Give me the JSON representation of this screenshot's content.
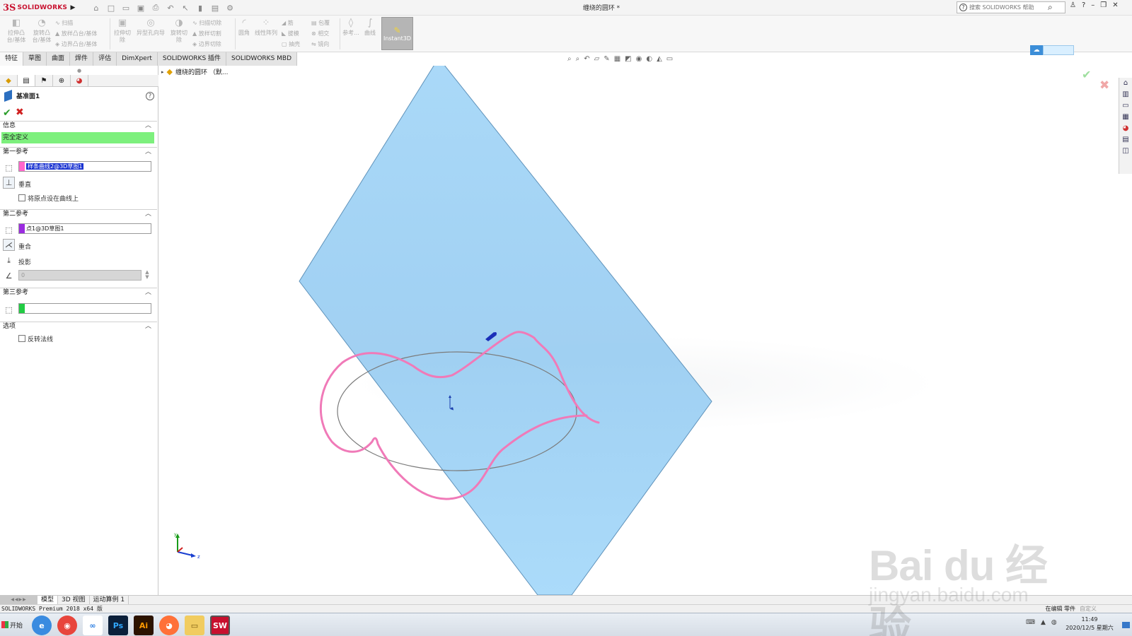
{
  "app": {
    "logo_text": "SOLIDWORKS",
    "document_title": "缠绕的圆环 *",
    "search_placeholder": "搜索 SOLIDWORKS 帮助"
  },
  "ribbon": {
    "extrude_boss": "拉伸凸台/基体",
    "revolve_boss": "旋转凸台/基体",
    "sweep": "扫描",
    "loft": "放样凸台/基体",
    "boundary": "边界凸台/基体",
    "extrude_cut": "拉伸切除",
    "hole_wizard": "异型孔向导",
    "revolve_cut": "旋转切除",
    "sweep_cut": "扫描切除",
    "loft_cut": "放样切割",
    "boundary_cut": "边界切除",
    "fillet": "圆角",
    "linear_pattern": "线性阵列",
    "rib": "筋",
    "draft": "拔模",
    "shell": "抽壳",
    "wrap": "包覆",
    "intersect": "相交",
    "mirror": "镜向",
    "reference": "参考...",
    "curves": "曲线",
    "instant3d": "Instant3D"
  },
  "tabs": [
    "特征",
    "草图",
    "曲面",
    "焊件",
    "评估",
    "DimXpert",
    "SOLIDWORKS 插件",
    "SOLIDWORKS MBD"
  ],
  "active_tab_index": 0,
  "property_manager": {
    "title": "基准面1",
    "sections": {
      "info": "信息",
      "first_ref": "第一参考",
      "second_ref": "第二参考",
      "third_ref": "第三参考",
      "options": "选项"
    },
    "info_status": "完全定义",
    "first_ref_value": "样条曲线2@3D草图1",
    "first_ref_relation": "垂直",
    "origin_on_curve": "将原点设在曲线上",
    "second_ref_value": "点1@3D草图1",
    "second_ref_relation1": "重合",
    "second_ref_relation2": "投影",
    "angle_value": "0",
    "third_ref_value": "",
    "flip_normal": "反转法线",
    "colors": {
      "first_ref_swatch": "#ff66cc",
      "second_ref_swatch": "#9b2be0",
      "third_ref_swatch": "#22cc44",
      "info_bar": "#7df07d"
    }
  },
  "viewport": {
    "feature_tree_label": "缠绕的圆环 （默...",
    "plane_fill": "#a8d8f8",
    "curve_color": "#f07ab8"
  },
  "bottom_tabs": [
    "模型",
    "3D 视图",
    "运动算例 1"
  ],
  "active_bottom_tab_index": 0,
  "status": {
    "version": "SOLIDWORKS Premium 2018 x64 版",
    "editing": "在编辑 零件",
    "custom": "自定义"
  },
  "taskbar": {
    "start_label": "开始",
    "apps": [
      "browser-icon",
      "chrome-icon",
      "baidu-netdisk-icon",
      "photoshop-icon",
      "illustrator-icon",
      "firefox-icon",
      "explorer-icon",
      "solidworks-icon"
    ],
    "time": "11:49",
    "date": "2020/12/5 星期六"
  },
  "watermark": {
    "main": "Bai du 经验",
    "url": "jingyan.baidu.com"
  }
}
